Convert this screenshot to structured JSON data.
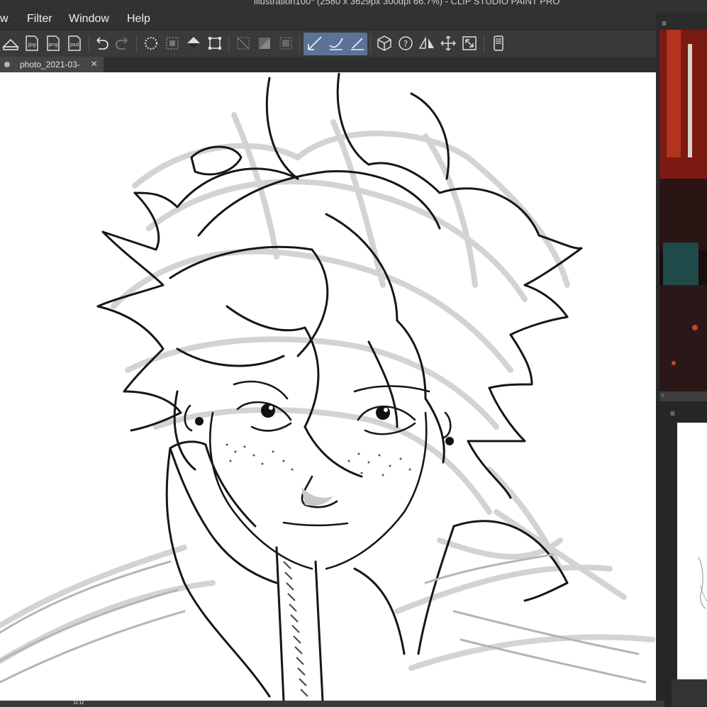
{
  "window": {
    "title": "illustration100* (2580 x 3629px 300dpi 66.7%) - CLIP STUDIO PAINT PRO"
  },
  "menubar": {
    "items": [
      {
        "label": "w"
      },
      {
        "label": "Filter"
      },
      {
        "label": "Window"
      },
      {
        "label": "Help"
      }
    ]
  },
  "toolbar": {
    "icons": [
      "export-image-icon",
      "export-jpg-icon",
      "export-png-icon",
      "export-psd-icon",
      "undo-icon",
      "redo-icon",
      "clear-selection-icon",
      "invert-selection-icon",
      "fill-icon",
      "transform-icon",
      "hide-selection-icon",
      "clear-outside-icon",
      "convert-to-layer-icon",
      "stroke-snap-ruler-icon",
      "stroke-snap-special-icon",
      "stroke-snap-grid-icon",
      "3d-model-icon",
      "help-icon",
      "flip-horizontal-icon",
      "move-icon",
      "fit-window-icon",
      "smartphone-icon"
    ],
    "highlight_color": "#5b7396"
  },
  "tabs": [
    {
      "title": "photo_2021-03-",
      "close_glyph": "×"
    }
  ],
  "status": {
    "zoom": "0.0"
  },
  "panel_handle_glyph": "≡",
  "colors": {
    "canvas": "#ffffff",
    "ui_dark": "#2b2b2b",
    "line_art": "#1a1a1a",
    "sketch": "#cfcfcf"
  }
}
